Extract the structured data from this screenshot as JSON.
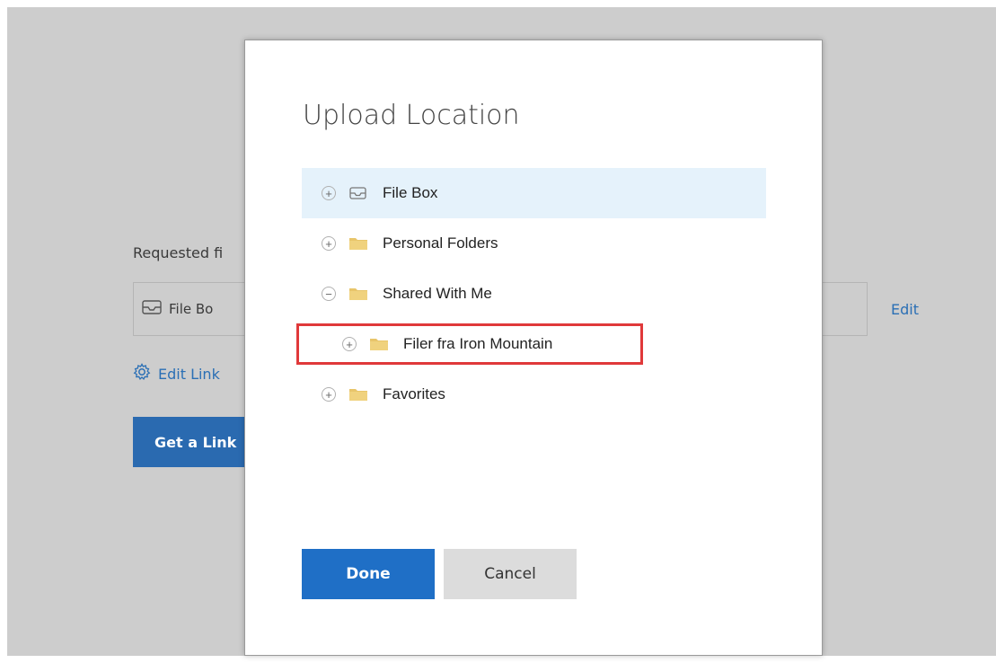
{
  "background": {
    "requested_label": "Requested fi",
    "field_value": "File Bo",
    "edit_label": "Edit",
    "edit_link_label": "Edit Link",
    "get_link_label": "Get a Link"
  },
  "dialog": {
    "title": "Upload Location",
    "tree": [
      {
        "label": "File Box",
        "toggle": "+",
        "icon": "inbox-icon",
        "selected": true
      },
      {
        "label": "Personal Folders",
        "toggle": "+",
        "icon": "folder-icon"
      },
      {
        "label": "Shared With Me",
        "toggle": "−",
        "icon": "folder-icon"
      },
      {
        "label": "Filer fra Iron Mountain",
        "toggle": "+",
        "icon": "folder-icon",
        "highlighted": true
      },
      {
        "label": "Favorites",
        "toggle": "+",
        "icon": "folder-icon"
      }
    ],
    "done_label": "Done",
    "cancel_label": "Cancel"
  },
  "colors": {
    "accent": "#1f6fc6",
    "selected_row": "#e5f2fb",
    "highlight_border": "#e0393a",
    "folder": "#e8c56a"
  }
}
